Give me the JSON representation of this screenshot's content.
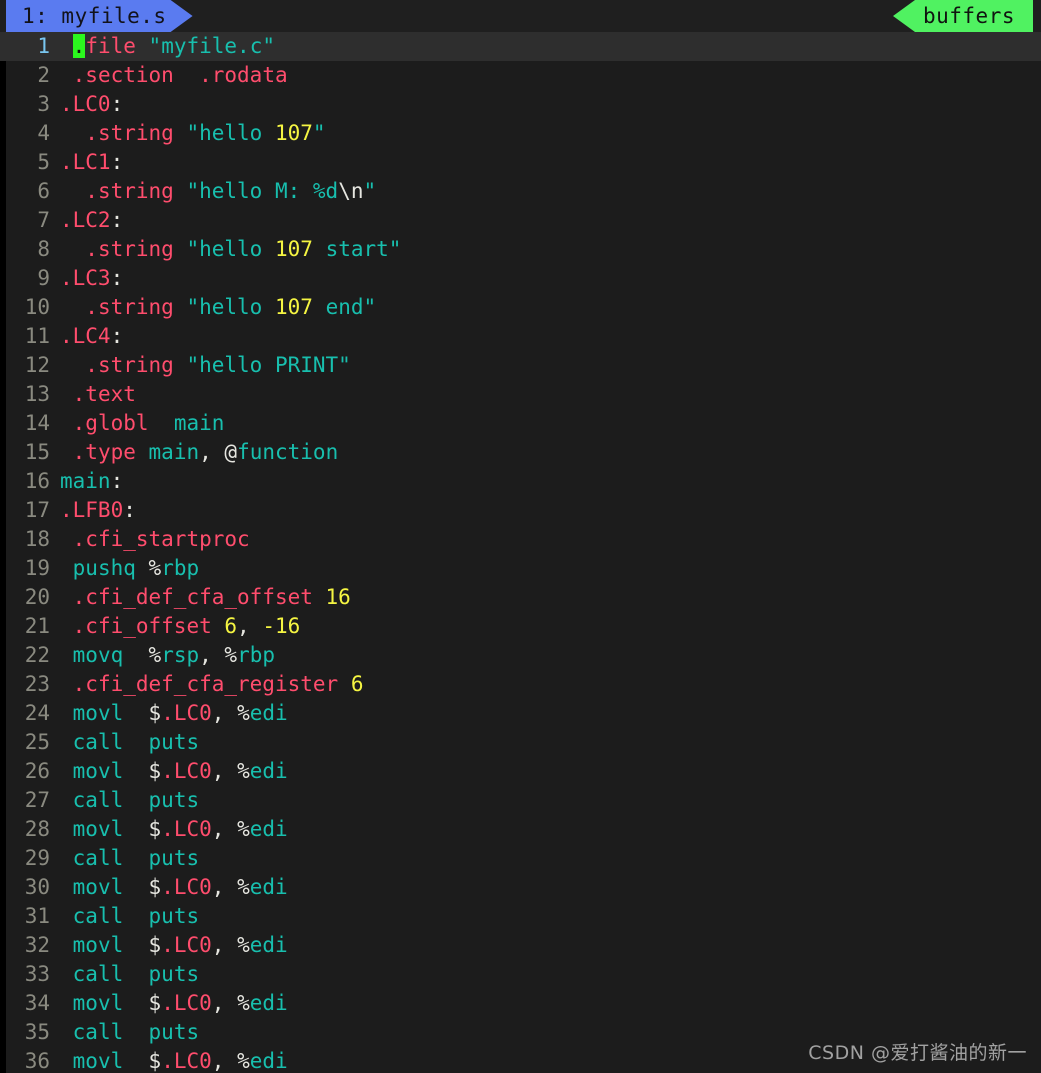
{
  "window": {
    "title": "myfile.s",
    "background": "#1c1c1c",
    "current_line_background": "#2e2e2e"
  },
  "tabline": {
    "active_tab": {
      "label": "1: myfile.s",
      "color": "#5a7bf0"
    },
    "buffers_tag": {
      "label": "buffers",
      "color": "#50f261"
    }
  },
  "colors": {
    "directive": "#ff4d6d",
    "string": "#18bfae",
    "number": "#f5f542",
    "identifier": "#18bfae",
    "punctuation": "#e6e6e0",
    "line_number": "#8a8a80",
    "current_line_number": "#79c6f0",
    "cursor": "#2bf81e"
  },
  "cursor": {
    "line": 1,
    "column": 2,
    "character": "."
  },
  "editor": {
    "lines": [
      {
        "n": "1",
        "current": true,
        "tokens": [
          {
            "t": " ",
            "c": "plain"
          },
          {
            "t": ".",
            "c": "cursor"
          },
          {
            "t": "file",
            "c": "dir"
          },
          {
            "t": " ",
            "c": "plain"
          },
          {
            "t": "\"myfile.c\"",
            "c": "str"
          }
        ]
      },
      {
        "n": "2",
        "tokens": [
          {
            "t": " ",
            "c": "plain"
          },
          {
            "t": ".section",
            "c": "dir"
          },
          {
            "t": "  ",
            "c": "plain"
          },
          {
            "t": ".rodata",
            "c": "dir"
          }
        ]
      },
      {
        "n": "3",
        "tokens": [
          {
            "t": ".LC0",
            "c": "dir"
          },
          {
            "t": ":",
            "c": "punct"
          }
        ]
      },
      {
        "n": "4",
        "tokens": [
          {
            "t": "  ",
            "c": "plain"
          },
          {
            "t": ".string",
            "c": "dir"
          },
          {
            "t": " ",
            "c": "plain"
          },
          {
            "t": "\"hello ",
            "c": "str"
          },
          {
            "t": "107",
            "c": "num"
          },
          {
            "t": "\"",
            "c": "str"
          }
        ]
      },
      {
        "n": "5",
        "tokens": [
          {
            "t": ".LC1",
            "c": "dir"
          },
          {
            "t": ":",
            "c": "punct"
          }
        ]
      },
      {
        "n": "6",
        "tokens": [
          {
            "t": "  ",
            "c": "plain"
          },
          {
            "t": ".string",
            "c": "dir"
          },
          {
            "t": " ",
            "c": "plain"
          },
          {
            "t": "\"hello M: %d",
            "c": "str"
          },
          {
            "t": "\\n",
            "c": "esc"
          },
          {
            "t": "\"",
            "c": "str"
          }
        ]
      },
      {
        "n": "7",
        "tokens": [
          {
            "t": ".LC2",
            "c": "dir"
          },
          {
            "t": ":",
            "c": "punct"
          }
        ]
      },
      {
        "n": "8",
        "tokens": [
          {
            "t": "  ",
            "c": "plain"
          },
          {
            "t": ".string",
            "c": "dir"
          },
          {
            "t": " ",
            "c": "plain"
          },
          {
            "t": "\"hello ",
            "c": "str"
          },
          {
            "t": "107",
            "c": "num"
          },
          {
            "t": " start\"",
            "c": "str"
          }
        ]
      },
      {
        "n": "9",
        "tokens": [
          {
            "t": ".LC3",
            "c": "dir"
          },
          {
            "t": ":",
            "c": "punct"
          }
        ]
      },
      {
        "n": "10",
        "tokens": [
          {
            "t": "  ",
            "c": "plain"
          },
          {
            "t": ".string",
            "c": "dir"
          },
          {
            "t": " ",
            "c": "plain"
          },
          {
            "t": "\"hello ",
            "c": "str"
          },
          {
            "t": "107",
            "c": "num"
          },
          {
            "t": " end\"",
            "c": "str"
          }
        ]
      },
      {
        "n": "11",
        "tokens": [
          {
            "t": ".LC4",
            "c": "dir"
          },
          {
            "t": ":",
            "c": "punct"
          }
        ]
      },
      {
        "n": "12",
        "tokens": [
          {
            "t": "  ",
            "c": "plain"
          },
          {
            "t": ".string",
            "c": "dir"
          },
          {
            "t": " ",
            "c": "plain"
          },
          {
            "t": "\"hello PRINT\"",
            "c": "str"
          }
        ]
      },
      {
        "n": "13",
        "tokens": [
          {
            "t": " ",
            "c": "plain"
          },
          {
            "t": ".text",
            "c": "dir"
          }
        ]
      },
      {
        "n": "14",
        "tokens": [
          {
            "t": " ",
            "c": "plain"
          },
          {
            "t": ".globl",
            "c": "dir"
          },
          {
            "t": "  ",
            "c": "plain"
          },
          {
            "t": "main",
            "c": "id"
          }
        ]
      },
      {
        "n": "15",
        "tokens": [
          {
            "t": " ",
            "c": "plain"
          },
          {
            "t": ".type",
            "c": "dir"
          },
          {
            "t": " ",
            "c": "plain"
          },
          {
            "t": "main",
            "c": "id"
          },
          {
            "t": ", ",
            "c": "punct"
          },
          {
            "t": "@",
            "c": "punct"
          },
          {
            "t": "function",
            "c": "id"
          }
        ]
      },
      {
        "n": "16",
        "tokens": [
          {
            "t": "main",
            "c": "id"
          },
          {
            "t": ":",
            "c": "punct"
          }
        ]
      },
      {
        "n": "17",
        "tokens": [
          {
            "t": ".LFB0",
            "c": "dir"
          },
          {
            "t": ":",
            "c": "punct"
          }
        ]
      },
      {
        "n": "18",
        "tokens": [
          {
            "t": " ",
            "c": "plain"
          },
          {
            "t": ".cfi_startproc",
            "c": "dir"
          }
        ]
      },
      {
        "n": "19",
        "tokens": [
          {
            "t": " ",
            "c": "plain"
          },
          {
            "t": "pushq",
            "c": "kw"
          },
          {
            "t": " ",
            "c": "plain"
          },
          {
            "t": "%",
            "c": "punct"
          },
          {
            "t": "rbp",
            "c": "id"
          }
        ]
      },
      {
        "n": "20",
        "tokens": [
          {
            "t": " ",
            "c": "plain"
          },
          {
            "t": ".cfi_def_cfa_offset",
            "c": "dir"
          },
          {
            "t": " ",
            "c": "plain"
          },
          {
            "t": "16",
            "c": "num"
          }
        ]
      },
      {
        "n": "21",
        "tokens": [
          {
            "t": " ",
            "c": "plain"
          },
          {
            "t": ".cfi_offset",
            "c": "dir"
          },
          {
            "t": " ",
            "c": "plain"
          },
          {
            "t": "6",
            "c": "num"
          },
          {
            "t": ", ",
            "c": "punct"
          },
          {
            "t": "-16",
            "c": "num"
          }
        ]
      },
      {
        "n": "22",
        "tokens": [
          {
            "t": " ",
            "c": "plain"
          },
          {
            "t": "movq",
            "c": "kw"
          },
          {
            "t": "  ",
            "c": "plain"
          },
          {
            "t": "%",
            "c": "punct"
          },
          {
            "t": "rsp",
            "c": "id"
          },
          {
            "t": ", ",
            "c": "punct"
          },
          {
            "t": "%",
            "c": "punct"
          },
          {
            "t": "rbp",
            "c": "id"
          }
        ]
      },
      {
        "n": "23",
        "tokens": [
          {
            "t": " ",
            "c": "plain"
          },
          {
            "t": ".cfi_def_cfa_register",
            "c": "dir"
          },
          {
            "t": " ",
            "c": "plain"
          },
          {
            "t": "6",
            "c": "num"
          }
        ]
      },
      {
        "n": "24",
        "tokens": [
          {
            "t": " ",
            "c": "plain"
          },
          {
            "t": "movl",
            "c": "kw"
          },
          {
            "t": "  ",
            "c": "plain"
          },
          {
            "t": "$",
            "c": "punct"
          },
          {
            "t": ".LC0",
            "c": "dir"
          },
          {
            "t": ", ",
            "c": "punct"
          },
          {
            "t": "%",
            "c": "punct"
          },
          {
            "t": "edi",
            "c": "id"
          }
        ]
      },
      {
        "n": "25",
        "tokens": [
          {
            "t": " ",
            "c": "plain"
          },
          {
            "t": "call",
            "c": "kw"
          },
          {
            "t": "  ",
            "c": "plain"
          },
          {
            "t": "puts",
            "c": "id"
          }
        ]
      },
      {
        "n": "26",
        "tokens": [
          {
            "t": " ",
            "c": "plain"
          },
          {
            "t": "movl",
            "c": "kw"
          },
          {
            "t": "  ",
            "c": "plain"
          },
          {
            "t": "$",
            "c": "punct"
          },
          {
            "t": ".LC0",
            "c": "dir"
          },
          {
            "t": ", ",
            "c": "punct"
          },
          {
            "t": "%",
            "c": "punct"
          },
          {
            "t": "edi",
            "c": "id"
          }
        ]
      },
      {
        "n": "27",
        "tokens": [
          {
            "t": " ",
            "c": "plain"
          },
          {
            "t": "call",
            "c": "kw"
          },
          {
            "t": "  ",
            "c": "plain"
          },
          {
            "t": "puts",
            "c": "id"
          }
        ]
      },
      {
        "n": "28",
        "tokens": [
          {
            "t": " ",
            "c": "plain"
          },
          {
            "t": "movl",
            "c": "kw"
          },
          {
            "t": "  ",
            "c": "plain"
          },
          {
            "t": "$",
            "c": "punct"
          },
          {
            "t": ".LC0",
            "c": "dir"
          },
          {
            "t": ", ",
            "c": "punct"
          },
          {
            "t": "%",
            "c": "punct"
          },
          {
            "t": "edi",
            "c": "id"
          }
        ]
      },
      {
        "n": "29",
        "tokens": [
          {
            "t": " ",
            "c": "plain"
          },
          {
            "t": "call",
            "c": "kw"
          },
          {
            "t": "  ",
            "c": "plain"
          },
          {
            "t": "puts",
            "c": "id"
          }
        ]
      },
      {
        "n": "30",
        "tokens": [
          {
            "t": " ",
            "c": "plain"
          },
          {
            "t": "movl",
            "c": "kw"
          },
          {
            "t": "  ",
            "c": "plain"
          },
          {
            "t": "$",
            "c": "punct"
          },
          {
            "t": ".LC0",
            "c": "dir"
          },
          {
            "t": ", ",
            "c": "punct"
          },
          {
            "t": "%",
            "c": "punct"
          },
          {
            "t": "edi",
            "c": "id"
          }
        ]
      },
      {
        "n": "31",
        "tokens": [
          {
            "t": " ",
            "c": "plain"
          },
          {
            "t": "call",
            "c": "kw"
          },
          {
            "t": "  ",
            "c": "plain"
          },
          {
            "t": "puts",
            "c": "id"
          }
        ]
      },
      {
        "n": "32",
        "tokens": [
          {
            "t": " ",
            "c": "plain"
          },
          {
            "t": "movl",
            "c": "kw"
          },
          {
            "t": "  ",
            "c": "plain"
          },
          {
            "t": "$",
            "c": "punct"
          },
          {
            "t": ".LC0",
            "c": "dir"
          },
          {
            "t": ", ",
            "c": "punct"
          },
          {
            "t": "%",
            "c": "punct"
          },
          {
            "t": "edi",
            "c": "id"
          }
        ]
      },
      {
        "n": "33",
        "tokens": [
          {
            "t": " ",
            "c": "plain"
          },
          {
            "t": "call",
            "c": "kw"
          },
          {
            "t": "  ",
            "c": "plain"
          },
          {
            "t": "puts",
            "c": "id"
          }
        ]
      },
      {
        "n": "34",
        "tokens": [
          {
            "t": " ",
            "c": "plain"
          },
          {
            "t": "movl",
            "c": "kw"
          },
          {
            "t": "  ",
            "c": "plain"
          },
          {
            "t": "$",
            "c": "punct"
          },
          {
            "t": ".LC0",
            "c": "dir"
          },
          {
            "t": ", ",
            "c": "punct"
          },
          {
            "t": "%",
            "c": "punct"
          },
          {
            "t": "edi",
            "c": "id"
          }
        ]
      },
      {
        "n": "35",
        "tokens": [
          {
            "t": " ",
            "c": "plain"
          },
          {
            "t": "call",
            "c": "kw"
          },
          {
            "t": "  ",
            "c": "plain"
          },
          {
            "t": "puts",
            "c": "id"
          }
        ]
      },
      {
        "n": "36",
        "tokens": [
          {
            "t": " ",
            "c": "plain"
          },
          {
            "t": "movl",
            "c": "kw"
          },
          {
            "t": "  ",
            "c": "plain"
          },
          {
            "t": "$",
            "c": "punct"
          },
          {
            "t": ".LC0",
            "c": "dir"
          },
          {
            "t": ", ",
            "c": "punct"
          },
          {
            "t": "%",
            "c": "punct"
          },
          {
            "t": "edi",
            "c": "id"
          }
        ]
      }
    ]
  },
  "watermark": {
    "text": "CSDN @爱打酱油的新一"
  }
}
